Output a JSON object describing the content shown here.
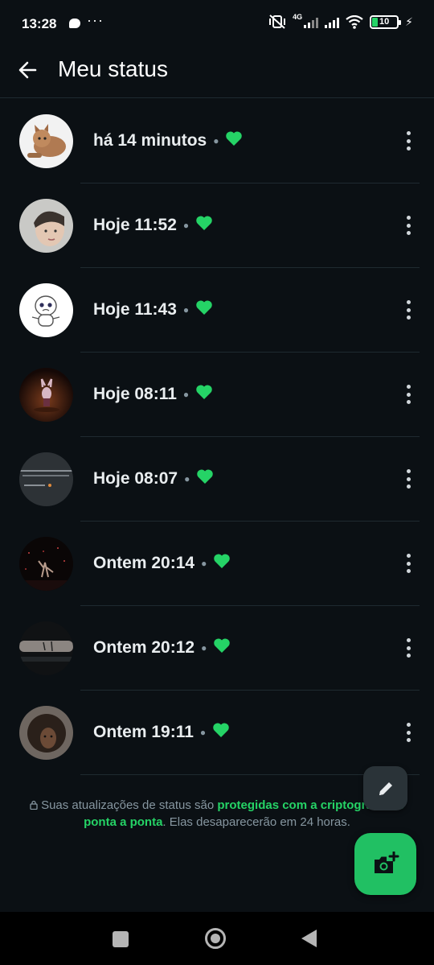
{
  "status_bar": {
    "time": "13:28",
    "network_label": "4G",
    "battery": "10"
  },
  "header": {
    "title": "Meu status"
  },
  "colors": {
    "accent": "#25d366",
    "background": "#0b1014"
  },
  "statuses": [
    {
      "time_label": "há 14 minutos",
      "liked": true,
      "thumbnail": "kitten"
    },
    {
      "time_label": "Hoje 11:52",
      "liked": true,
      "thumbnail": "person-face"
    },
    {
      "time_label": "Hoje 11:43",
      "liked": true,
      "thumbnail": "cartoon-character"
    },
    {
      "time_label": "Hoje 08:11",
      "liked": true,
      "thumbnail": "dark-scene-figure"
    },
    {
      "time_label": "Hoje 08:07",
      "liked": true,
      "thumbnail": "text-screenshot"
    },
    {
      "time_label": "Ontem 20:14",
      "liked": true,
      "thumbnail": "concert-stage"
    },
    {
      "time_label": "Ontem 20:12",
      "liked": true,
      "thumbnail": "arm-closeup"
    },
    {
      "time_label": "Ontem 19:11",
      "liked": true,
      "thumbnail": "curly-hair-person"
    }
  ],
  "footer_note": {
    "prefix": "Suas atualizações de status são ",
    "link": "protegidas com a criptografia de ponta a ponta",
    "suffix": ". Elas desaparecerão em 24 horas."
  },
  "fabs": {
    "pencil": "pencil-icon",
    "camera": "camera-add-icon"
  }
}
